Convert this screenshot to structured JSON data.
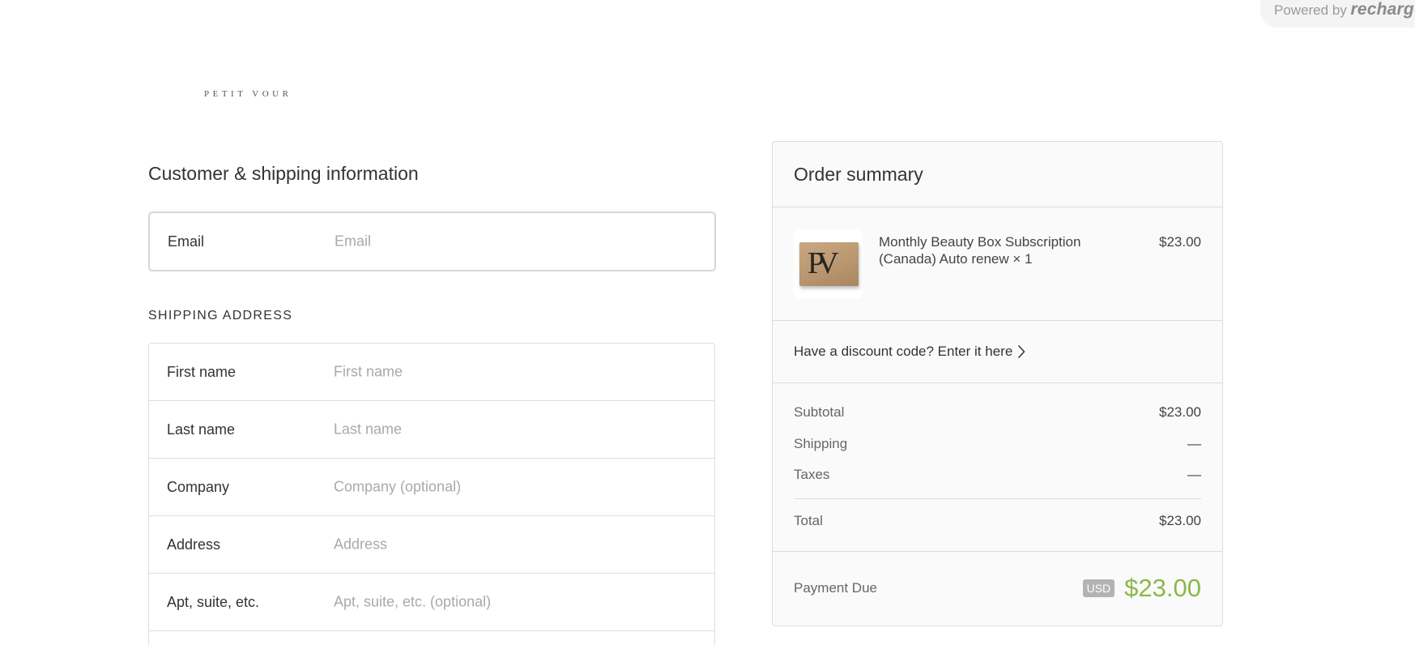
{
  "powered": {
    "prefix": "Powered by",
    "brand": "recharge"
  },
  "logo": "PETIT VOUR",
  "customer": {
    "title": "Customer & shipping information",
    "email": {
      "label": "Email",
      "placeholder": "Email",
      "value": ""
    }
  },
  "shipping": {
    "heading": "SHIPPING ADDRESS",
    "fields": [
      {
        "label": "First name",
        "placeholder": "First name"
      },
      {
        "label": "Last name",
        "placeholder": "Last name"
      },
      {
        "label": "Company",
        "placeholder": "Company (optional)"
      },
      {
        "label": "Address",
        "placeholder": "Address"
      },
      {
        "label": "Apt, suite, etc.",
        "placeholder": "Apt, suite, etc. (optional)"
      }
    ]
  },
  "summary": {
    "title": "Order summary",
    "product": {
      "thumb_text": "PV",
      "name": "Monthly Beauty Box Subscription (Canada) Auto renew × 1",
      "price": "$23.00"
    },
    "discount_text": "Have a discount code? Enter it here",
    "lines": {
      "subtotal_label": "Subtotal",
      "subtotal_value": "$23.00",
      "shipping_label": "Shipping",
      "shipping_value": "—",
      "taxes_label": "Taxes",
      "taxes_value": "—",
      "total_label": "Total",
      "total_value": "$23.00"
    },
    "payment": {
      "label": "Payment Due",
      "currency": "USD",
      "amount": "$23.00"
    }
  },
  "colors": {
    "accent_green": "#8bb84a",
    "panel_bg": "#fafafa",
    "border": "#dddddd"
  }
}
